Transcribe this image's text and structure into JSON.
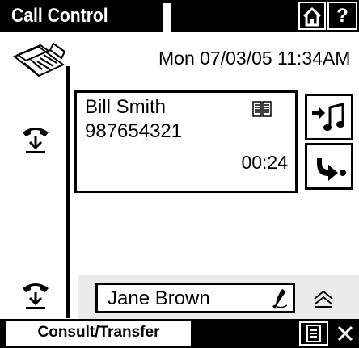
{
  "header": {
    "title": "Call Control",
    "help_label": "?",
    "icons": [
      "home-icon",
      "help-icon"
    ]
  },
  "datetime": "Mon 07/03/05 11:34AM",
  "active_call": {
    "name": "Bill Smith",
    "number": "987654321",
    "timer": "00:24",
    "icons": [
      "phonebook-icon"
    ]
  },
  "side_actions": {
    "icons": [
      "transfer-to-music-icon",
      "forward-call-icon"
    ]
  },
  "left_rail": {
    "icons": [
      "fax-phone-icon",
      "handset-hold-icon",
      "handset-hold-icon"
    ]
  },
  "consult": {
    "name": "Jane Brown",
    "icons": [
      "dial-icon",
      "scroll-up-icon"
    ]
  },
  "bottom_bar": {
    "softkey_label": "Consult/Transfer",
    "icons": [
      "list-icon",
      "close-icon"
    ]
  },
  "colors": {
    "bar": "#000000",
    "background": "#ffffff",
    "panel": "#ebebeb"
  }
}
